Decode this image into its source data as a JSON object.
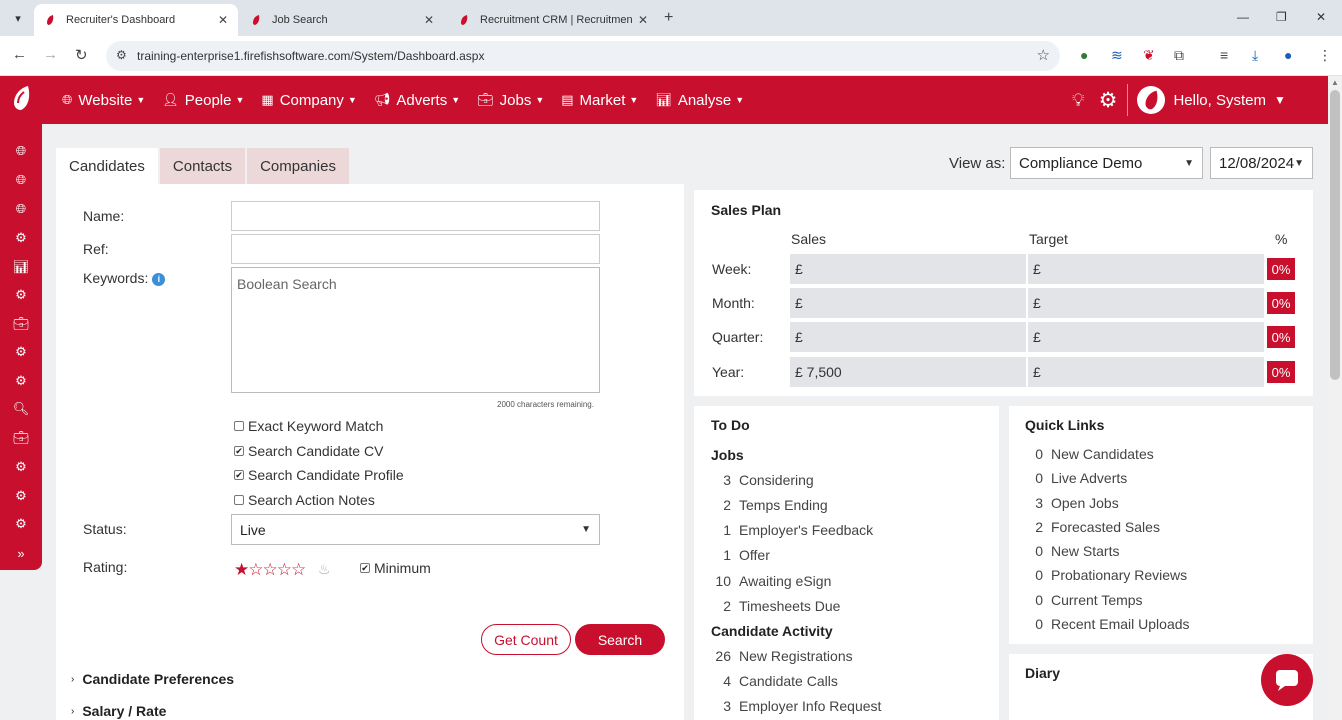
{
  "browser": {
    "tabs": [
      {
        "label": "Recruiter's Dashboard",
        "active": true
      },
      {
        "label": "Job Search",
        "active": false
      },
      {
        "label": "Recruitment CRM | Recruitment",
        "active": false
      }
    ],
    "url": "training-enterprise1.firefishsoftware.com/System/Dashboard.aspx"
  },
  "header": {
    "menu": [
      {
        "label": "Website",
        "icon": "globe-icon"
      },
      {
        "label": "People",
        "icon": "person-icon"
      },
      {
        "label": "Company",
        "icon": "building-icon"
      },
      {
        "label": "Adverts",
        "icon": "megaphone-icon"
      },
      {
        "label": "Jobs",
        "icon": "briefcase-icon"
      },
      {
        "label": "Market",
        "icon": "market-icon"
      },
      {
        "label": "Analyse",
        "icon": "chart-icon"
      }
    ],
    "greeting": "Hello, System",
    "brand_color": "#c8102e"
  },
  "search": {
    "tabs": [
      "Candidates",
      "Contacts",
      "Companies"
    ],
    "name_label": "Name:",
    "ref_label": "Ref:",
    "keywords_label": "Keywords:",
    "keywords_placeholder": "Boolean Search",
    "chars_remaining": "2000 characters remaining.",
    "options": [
      {
        "label": "Exact Keyword Match",
        "checked": false
      },
      {
        "label": "Search Candidate CV",
        "checked": true
      },
      {
        "label": "Search Candidate Profile",
        "checked": true
      },
      {
        "label": "Search Action Notes",
        "checked": false
      }
    ],
    "status_label": "Status:",
    "status_value": "Live",
    "rating_label": "Rating:",
    "rating_value": 1,
    "rating_max": 5,
    "minimum_label": "Minimum",
    "minimum_checked": true,
    "get_count": "Get Count",
    "search_btn": "Search",
    "accordions": [
      "Candidate Preferences",
      "Salary / Rate"
    ]
  },
  "view_as": {
    "label": "View as:",
    "value": "Compliance Demo",
    "date": "12/08/2024"
  },
  "sales_plan": {
    "title": "Sales Plan",
    "col_sales": "Sales",
    "col_target": "Target",
    "col_pct": "%",
    "rows": [
      {
        "label": "Week:",
        "sales": "£",
        "target": "£",
        "pct": "0%"
      },
      {
        "label": "Month:",
        "sales": "£",
        "target": "£",
        "pct": "0%"
      },
      {
        "label": "Quarter:",
        "sales": "£",
        "target": "£",
        "pct": "0%"
      },
      {
        "label": "Year:",
        "sales": "£ 7,500",
        "target": "£",
        "pct": "0%"
      }
    ]
  },
  "todo": {
    "title": "To Do",
    "jobs_title": "Jobs",
    "jobs": [
      {
        "n": "3",
        "label": "Considering"
      },
      {
        "n": "2",
        "label": "Temps Ending"
      },
      {
        "n": "1",
        "label": "Employer's Feedback"
      },
      {
        "n": "1",
        "label": "Offer"
      },
      {
        "n": "10",
        "label": "Awaiting eSign"
      },
      {
        "n": "2",
        "label": "Timesheets Due"
      }
    ],
    "activity_title": "Candidate Activity",
    "activity": [
      {
        "n": "26",
        "label": "New Registrations"
      },
      {
        "n": "4",
        "label": "Candidate Calls"
      },
      {
        "n": "3",
        "label": "Employer Info Request"
      }
    ]
  },
  "quick_links": {
    "title": "Quick Links",
    "items": [
      {
        "n": "0",
        "label": "New Candidates"
      },
      {
        "n": "0",
        "label": "Live Adverts"
      },
      {
        "n": "3",
        "label": "Open Jobs"
      },
      {
        "n": "2",
        "label": "Forecasted Sales"
      },
      {
        "n": "0",
        "label": "New Starts"
      },
      {
        "n": "0",
        "label": "Probationary Reviews"
      },
      {
        "n": "0",
        "label": "Current Temps"
      },
      {
        "n": "0",
        "label": "Recent Email Uploads"
      }
    ]
  },
  "diary": {
    "title": "Diary"
  }
}
